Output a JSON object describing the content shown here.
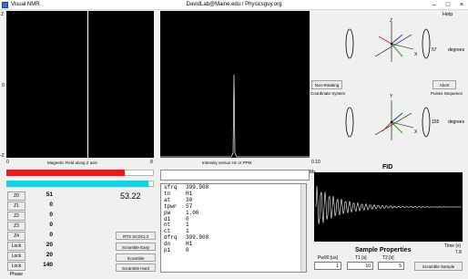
{
  "window": {
    "title": "Visual NMR",
    "center_title": "DavidLab@Maine.edu / Physicsguy.org",
    "minimize": "–",
    "maximize": "□",
    "close": "×"
  },
  "menu": {
    "help": "Help"
  },
  "mag_plot": {
    "z_top": "Z",
    "z_mid": "0",
    "z_bottom": "-Z",
    "x_left": "0",
    "x_right": "8",
    "caption": "Magnetic Field along Z axis"
  },
  "spectrum": {
    "caption": "Intensity versus Hz or PPM",
    "x_right": "0.10",
    "mx_label": "Mx"
  },
  "coord": {
    "z_label": "Z",
    "x_label": "X",
    "degrees_value": "57",
    "degrees_unit": "degrees",
    "non_rotating_button": "Non-Rotating",
    "coord_caption": "Coordinate System",
    "abort_button": "Abort",
    "pulse_caption": "Pulses Sequence",
    "y_label": "Y",
    "x2_label": "X",
    "degrees2_value": "155",
    "degrees2_unit": "degrees"
  },
  "shims": {
    "rows": [
      {
        "label": "Z0",
        "value": "51"
      },
      {
        "label": "Z1",
        "value": "0"
      },
      {
        "label": "Z2",
        "value": "0"
      },
      {
        "label": "Z3",
        "value": "0"
      },
      {
        "label": "Z4",
        "value": "0"
      },
      {
        "label": "Lock Gain",
        "value": "20"
      },
      {
        "label": "Lock Power",
        "value": "20"
      },
      {
        "label": "Lock Phase",
        "value": "140"
      }
    ],
    "big_value": "53.22",
    "red_level": 0.8,
    "cyan_level": 0.96
  },
  "actions": {
    "rts": "RTS SCDCL3",
    "scramble_easy": "Scramble Easy",
    "scramble": "Scramble",
    "scramble_hard": "Scramble Hard"
  },
  "params": {
    "rows": [
      {
        "name": "sfrq",
        "value": "399.908"
      },
      {
        "name": "tn",
        "value": "H1"
      },
      {
        "name": "at",
        "value": "30"
      },
      {
        "name": "tpwr",
        "value": "57"
      },
      {
        "name": "pw",
        "value": "1.00"
      },
      {
        "name": "d1",
        "value": "0"
      },
      {
        "name": "nt",
        "value": "1"
      },
      {
        "name": "ct",
        "value": "1"
      },
      {
        "name": "dfrq",
        "value": "399.908"
      },
      {
        "name": "dn",
        "value": "H1"
      },
      {
        "name": "p1",
        "value": "0"
      }
    ]
  },
  "fid": {
    "title": "FID",
    "time_label": "Time (s)",
    "time_value": "7.8"
  },
  "sample": {
    "title": "Sample Properties",
    "pw_label": "Pw90 [us]",
    "pw_value": "1",
    "t1_label": "T1 [s]",
    "t1_value": "10",
    "t2_label": "T2 [s]",
    "t2_value": "5",
    "scramble_sample": "Scramble Sample"
  }
}
